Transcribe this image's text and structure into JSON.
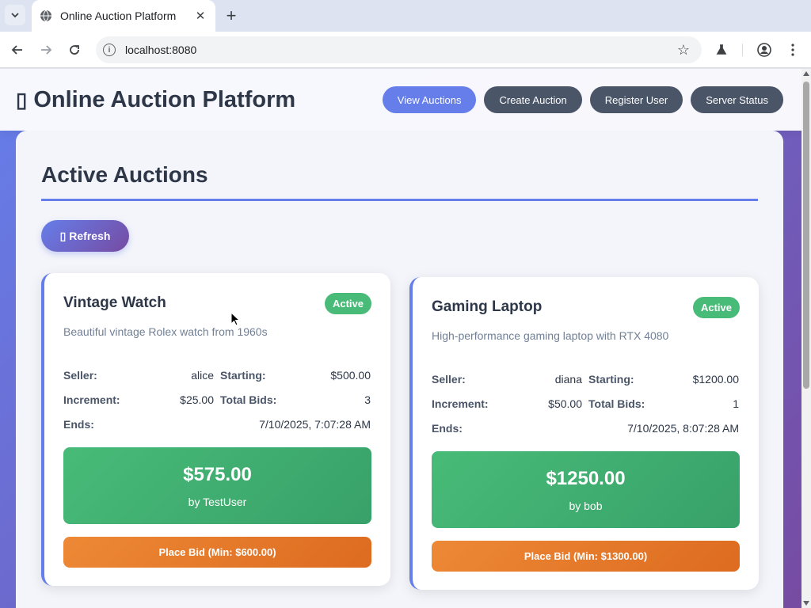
{
  "browser": {
    "tab_title": "Online Auction Platform",
    "url": "localhost:8080"
  },
  "app": {
    "title": "Online Auction Platform",
    "nav": [
      {
        "label": "View Auctions",
        "active": true
      },
      {
        "label": "Create Auction",
        "active": false
      },
      {
        "label": "Register User",
        "active": false
      },
      {
        "label": "Server Status",
        "active": false
      }
    ]
  },
  "main": {
    "section_title": "Active Auctions",
    "refresh_label": "Refresh",
    "auctions": [
      {
        "title": "Vintage Watch",
        "status": "Active",
        "description": "Beautiful vintage Rolex watch from 1960s",
        "seller_label": "Seller:",
        "seller": "alice",
        "starting_label": "Starting:",
        "starting": "$500.00",
        "increment_label": "Increment:",
        "increment": "$25.00",
        "total_bids_label": "Total Bids:",
        "total_bids": "3",
        "ends_label": "Ends:",
        "ends": "7/10/2025, 7:07:28 AM",
        "current_bid": "$575.00",
        "current_bidder": "by TestUser",
        "place_bid_label": "Place Bid (Min: $600.00)"
      },
      {
        "title": "Gaming Laptop",
        "status": "Active",
        "description": "High-performance gaming laptop with RTX 4080",
        "seller_label": "Seller:",
        "seller": "diana",
        "starting_label": "Starting:",
        "starting": "$1200.00",
        "increment_label": "Increment:",
        "increment": "$50.00",
        "total_bids_label": "Total Bids:",
        "total_bids": "1",
        "ends_label": "Ends:",
        "ends": "7/10/2025, 8:07:28 AM",
        "current_bid": "$1250.00",
        "current_bidder": "by bob",
        "place_bid_label": "Place Bid (Min: $1300.00)"
      }
    ]
  },
  "colors": {
    "accent": "#667eea",
    "success": "#48bb78",
    "warning": "#ed8936"
  }
}
